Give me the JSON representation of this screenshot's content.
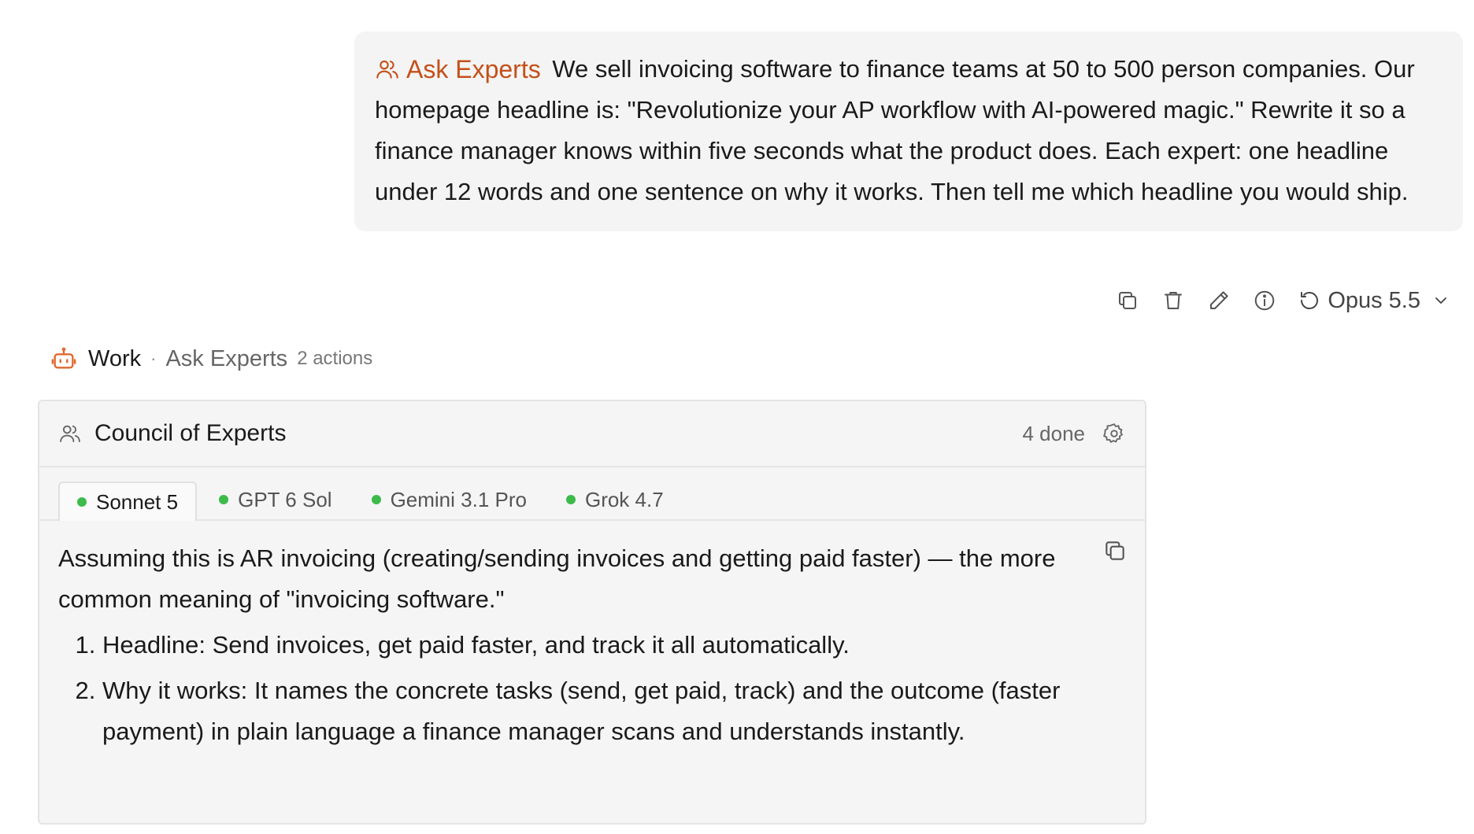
{
  "user_message": {
    "tag_label": "Ask Experts",
    "text": "We sell invoicing software to finance teams at 50 to 500 person companies. Our homepage headline is: \"Revolutionize your AP workflow with AI-powered magic.\" Rewrite it so a finance manager knows within five seconds what the product does. Each expert: one headline under 12 words and one sentence on why it works. Then tell me which headline you would ship."
  },
  "message_actions": {
    "icons": [
      "copy-icon",
      "trash-icon",
      "pencil-icon",
      "info-icon",
      "retry-icon"
    ],
    "model": "Opus 5.5"
  },
  "work_line": {
    "work": "Work",
    "separator": "·",
    "tool": "Ask Experts",
    "actions": "2 actions"
  },
  "panel": {
    "title": "Council of Experts",
    "status": "4 done",
    "tabs": [
      {
        "label": "Sonnet 5",
        "active": true
      },
      {
        "label": "GPT 6 Sol",
        "active": false
      },
      {
        "label": "Gemini 3.1 Pro",
        "active": false
      },
      {
        "label": "Grok 4.7",
        "active": false
      }
    ],
    "status_color": "#3dbb4a",
    "response": {
      "intro": "Assuming this is AR invoicing (creating/sending invoices and getting paid faster) — the more common meaning of \"invoicing software.\"",
      "items": [
        "Headline: Send invoices, get paid faster, and track it all automatically.",
        "Why it works: It names the concrete tasks (send, get paid, track) and the outcome (faster payment) in plain language a finance manager scans and understands instantly."
      ]
    }
  },
  "colors": {
    "accent": "#c4501a",
    "bot_icon": "#e06a2c"
  }
}
